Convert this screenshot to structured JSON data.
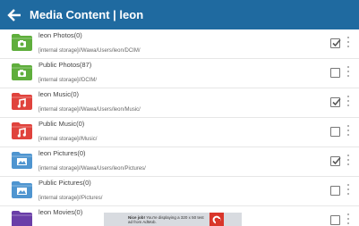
{
  "app": {
    "title": "Media Content | leon",
    "accent": "#1f6aa0"
  },
  "rows": [
    {
      "name": "leon Photos(0)",
      "path": "[internal storage]//Wawa/Users/leon/DCIM/",
      "type": "photos",
      "color": "#5fae3c",
      "checked": true
    },
    {
      "name": "Public Photos(87)",
      "path": "[internal storage]//DCIM/",
      "type": "photos",
      "color": "#5fae3c",
      "checked": false
    },
    {
      "name": "leon Music(0)",
      "path": "[internal storage]//Wawa/Users/leon/Music/",
      "type": "music",
      "color": "#e0433d",
      "checked": true
    },
    {
      "name": "Public Music(0)",
      "path": "[internal storage]//Music/",
      "type": "music",
      "color": "#e0433d",
      "checked": false
    },
    {
      "name": "leon Pictures(0)",
      "path": "[internal storage]//Wawa/Users/leon/Pictures/",
      "type": "pictures",
      "color": "#4f95d0",
      "checked": true
    },
    {
      "name": "Public Pictures(0)",
      "path": "[internal storage]//Pictures/",
      "type": "pictures",
      "color": "#4f95d0",
      "checked": false
    },
    {
      "name": "leon Movies(0)",
      "path": "",
      "type": "movies",
      "color": "#6a3ea8",
      "checked": false
    }
  ],
  "banner": {
    "bold": "Nice job!",
    "text": "You're displaying a 320 x 50 test ad from AdMob."
  }
}
